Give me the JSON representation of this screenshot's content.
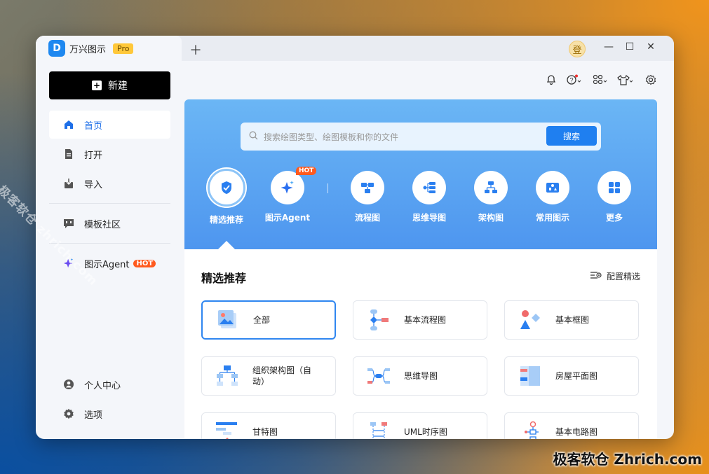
{
  "app": {
    "name": "万兴图示",
    "badge": "Pro",
    "logo_letter": "D",
    "login_char": "登"
  },
  "sidebar": {
    "new_label": "新建",
    "items": [
      {
        "label": "首页",
        "icon": "home-icon"
      },
      {
        "label": "打开",
        "icon": "file-icon"
      },
      {
        "label": "导入",
        "icon": "import-icon"
      },
      {
        "label": "模板社区",
        "icon": "chat-icon"
      },
      {
        "label": "图示Agent",
        "icon": "sparkle-icon",
        "badge": "HOT"
      },
      {
        "label": "个人中心",
        "icon": "user-icon"
      },
      {
        "label": "选项",
        "icon": "settings-icon"
      }
    ]
  },
  "search": {
    "placeholder": "搜索绘图类型、绘图模板和你的文件",
    "button": "搜索"
  },
  "categories": [
    {
      "label": "精选推荐",
      "icon": "featured-icon"
    },
    {
      "label": "图示Agent",
      "icon": "agent-icon",
      "badge": "HOT"
    },
    {
      "label": "流程图",
      "icon": "flowchart-icon"
    },
    {
      "label": "思维导图",
      "icon": "mindmap-icon"
    },
    {
      "label": "架构图",
      "icon": "architecture-icon"
    },
    {
      "label": "常用图示",
      "icon": "common-diagram-icon"
    },
    {
      "label": "更多",
      "icon": "more-icon"
    }
  ],
  "section": {
    "title": "精选推荐",
    "config_label": "配置精选"
  },
  "cards": [
    {
      "label": "全部"
    },
    {
      "label": "基本流程图"
    },
    {
      "label": "基本框图"
    },
    {
      "label": "组织架构图（自动）"
    },
    {
      "label": "思维导图"
    },
    {
      "label": "房屋平面图"
    },
    {
      "label": "甘特图"
    },
    {
      "label": "UML时序图"
    },
    {
      "label": "基本电路图"
    }
  ],
  "colors": {
    "accent": "#1e7ff0",
    "hot": "#ff5a1e",
    "hero_top": "#6bb6f5",
    "hero_bottom": "#4e96ef"
  },
  "watermark": {
    "diagonal": "极客软仓 zhrich.com",
    "bottom": "极客软仓 Zhrich.com"
  }
}
